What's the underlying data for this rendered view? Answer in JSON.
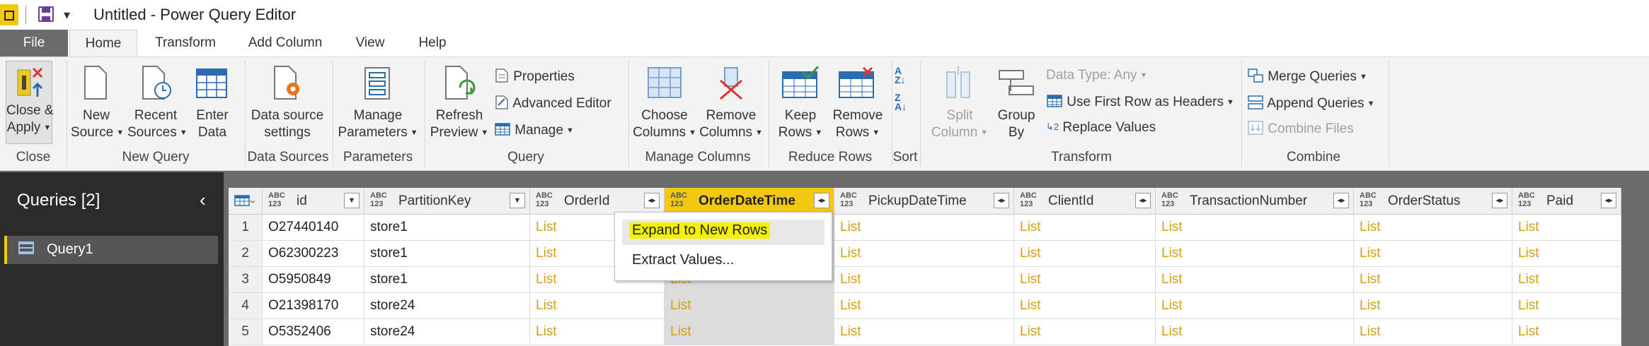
{
  "window": {
    "title": "Untitled - Power Query Editor"
  },
  "menu_tabs": [
    "File",
    "Home",
    "Transform",
    "Add Column",
    "View",
    "Help"
  ],
  "ribbon": {
    "close": {
      "button": "Close &\nApply",
      "group": "Close"
    },
    "new_query": {
      "new_source": "New\nSource",
      "recent_sources": "Recent\nSources",
      "enter_data": "Enter\nData",
      "group": "New Query"
    },
    "data_sources": {
      "settings": "Data source\nsettings",
      "group": "Data Sources"
    },
    "parameters": {
      "manage": "Manage\nParameters",
      "group": "Parameters"
    },
    "query": {
      "refresh": "Refresh\nPreview",
      "properties": "Properties",
      "advanced_editor": "Advanced Editor",
      "manage": "Manage",
      "group": "Query"
    },
    "manage_columns": {
      "choose": "Choose\nColumns",
      "remove": "Remove\nColumns",
      "group": "Manage Columns"
    },
    "reduce_rows": {
      "keep": "Keep\nRows",
      "remove": "Remove\nRows",
      "group": "Reduce Rows"
    },
    "sort": {
      "group": "Sort"
    },
    "transform": {
      "split": "Split\nColumn",
      "group_by": "Group\nBy",
      "data_type": "Data Type: Any",
      "first_row": "Use First Row as Headers",
      "replace": "Replace Values",
      "group": "Transform"
    },
    "combine": {
      "merge": "Merge Queries",
      "append": "Append Queries",
      "combine_files": "Combine Files",
      "group": "Combine"
    }
  },
  "queries_pane": {
    "title": "Queries [2]",
    "items": [
      "Query1"
    ]
  },
  "grid": {
    "type_label": "ABC\n123",
    "columns": [
      "id",
      "PartitionKey",
      "OrderId",
      "OrderDateTime",
      "PickupDateTime",
      "ClientId",
      "TransactionNumber",
      "OrderStatus",
      "Paid"
    ],
    "rows": [
      [
        "1",
        "O27440140",
        "store1",
        "List",
        "List",
        "List",
        "List",
        "List",
        "List",
        "List"
      ],
      [
        "2",
        "O62300223",
        "store1",
        "List",
        "List",
        "List",
        "List",
        "List",
        "List",
        "List"
      ],
      [
        "3",
        "O5950849",
        "store1",
        "List",
        "List",
        "List",
        "List",
        "List",
        "List",
        "List"
      ],
      [
        "4",
        "O21398170",
        "store24",
        "List",
        "List",
        "List",
        "List",
        "List",
        "List",
        "List"
      ],
      [
        "5",
        "O5352406",
        "store24",
        "List",
        "List",
        "List",
        "List",
        "List",
        "List",
        "List"
      ]
    ]
  },
  "context_menu": {
    "items": [
      "Expand to New Rows",
      "Extract Values..."
    ]
  }
}
